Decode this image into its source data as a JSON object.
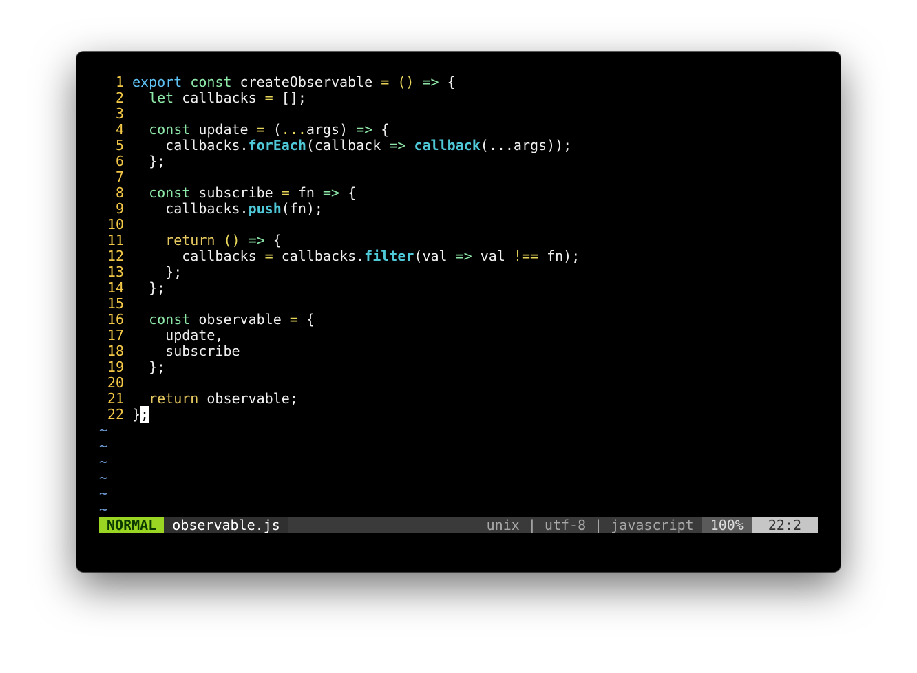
{
  "editor": {
    "lines": [
      [
        {
          "t": "export",
          "c": "kw-blue"
        },
        {
          "t": " "
        },
        {
          "t": "const",
          "c": "kw-green"
        },
        {
          "t": " createObservable "
        },
        {
          "t": "=",
          "c": "op"
        },
        {
          "t": " "
        },
        {
          "t": "()",
          "c": "op"
        },
        {
          "t": " "
        },
        {
          "t": "=>",
          "c": "kw-green"
        },
        {
          "t": " {"
        }
      ],
      [
        {
          "t": "  "
        },
        {
          "t": "let",
          "c": "kw-green"
        },
        {
          "t": " callbacks "
        },
        {
          "t": "=",
          "c": "op"
        },
        {
          "t": " [];"
        }
      ],
      [],
      [
        {
          "t": "  "
        },
        {
          "t": "const",
          "c": "kw-green"
        },
        {
          "t": " update "
        },
        {
          "t": "=",
          "c": "op"
        },
        {
          "t": " ("
        },
        {
          "t": "...",
          "c": "op"
        },
        {
          "t": "args) "
        },
        {
          "t": "=>",
          "c": "kw-green"
        },
        {
          "t": " {"
        }
      ],
      [
        {
          "t": "    callbacks."
        },
        {
          "t": "forEach",
          "c": "fn"
        },
        {
          "t": "(callback "
        },
        {
          "t": "=>",
          "c": "kw-green"
        },
        {
          "t": " "
        },
        {
          "t": "callback",
          "c": "fn"
        },
        {
          "t": "(...args));"
        }
      ],
      [
        {
          "t": "  };"
        }
      ],
      [],
      [
        {
          "t": "  "
        },
        {
          "t": "const",
          "c": "kw-green"
        },
        {
          "t": " subscribe "
        },
        {
          "t": "=",
          "c": "op"
        },
        {
          "t": " fn "
        },
        {
          "t": "=>",
          "c": "kw-green"
        },
        {
          "t": " {"
        }
      ],
      [
        {
          "t": "    callbacks."
        },
        {
          "t": "push",
          "c": "fn"
        },
        {
          "t": "(fn);"
        }
      ],
      [],
      [
        {
          "t": "    "
        },
        {
          "t": "return",
          "c": "kw-yellow"
        },
        {
          "t": " "
        },
        {
          "t": "()",
          "c": "op"
        },
        {
          "t": " "
        },
        {
          "t": "=>",
          "c": "kw-green"
        },
        {
          "t": " {"
        }
      ],
      [
        {
          "t": "      callbacks "
        },
        {
          "t": "=",
          "c": "op"
        },
        {
          "t": " callbacks."
        },
        {
          "t": "filter",
          "c": "fn"
        },
        {
          "t": "(val "
        },
        {
          "t": "=>",
          "c": "kw-green"
        },
        {
          "t": " val "
        },
        {
          "t": "!==",
          "c": "op"
        },
        {
          "t": " fn);"
        }
      ],
      [
        {
          "t": "    };"
        }
      ],
      [
        {
          "t": "  };"
        }
      ],
      [],
      [
        {
          "t": "  "
        },
        {
          "t": "const",
          "c": "kw-green"
        },
        {
          "t": " observable "
        },
        {
          "t": "=",
          "c": "op"
        },
        {
          "t": " {"
        }
      ],
      [
        {
          "t": "    update,"
        }
      ],
      [
        {
          "t": "    subscribe"
        }
      ],
      [
        {
          "t": "  };"
        }
      ],
      [],
      [
        {
          "t": "  "
        },
        {
          "t": "return",
          "c": "kw-yellow"
        },
        {
          "t": " observable;"
        }
      ],
      [
        {
          "t": "}"
        },
        {
          "t": ";",
          "c": "cursor"
        }
      ]
    ],
    "tilde_count": 6,
    "tilde_char": "~"
  },
  "statusline": {
    "mode": "NORMAL",
    "filename": "observable.js",
    "fileinfo": "unix | utf-8 | javascript",
    "percent": "100%",
    "position": "22:2"
  },
  "colors": {
    "line_number": "#f3c848",
    "mode_bg": "#9bd524",
    "keyword_blue": "#5fc3f5",
    "keyword_green": "#8ee8a8",
    "function": "#4fc8d8",
    "tilde": "#6f9bd6"
  }
}
